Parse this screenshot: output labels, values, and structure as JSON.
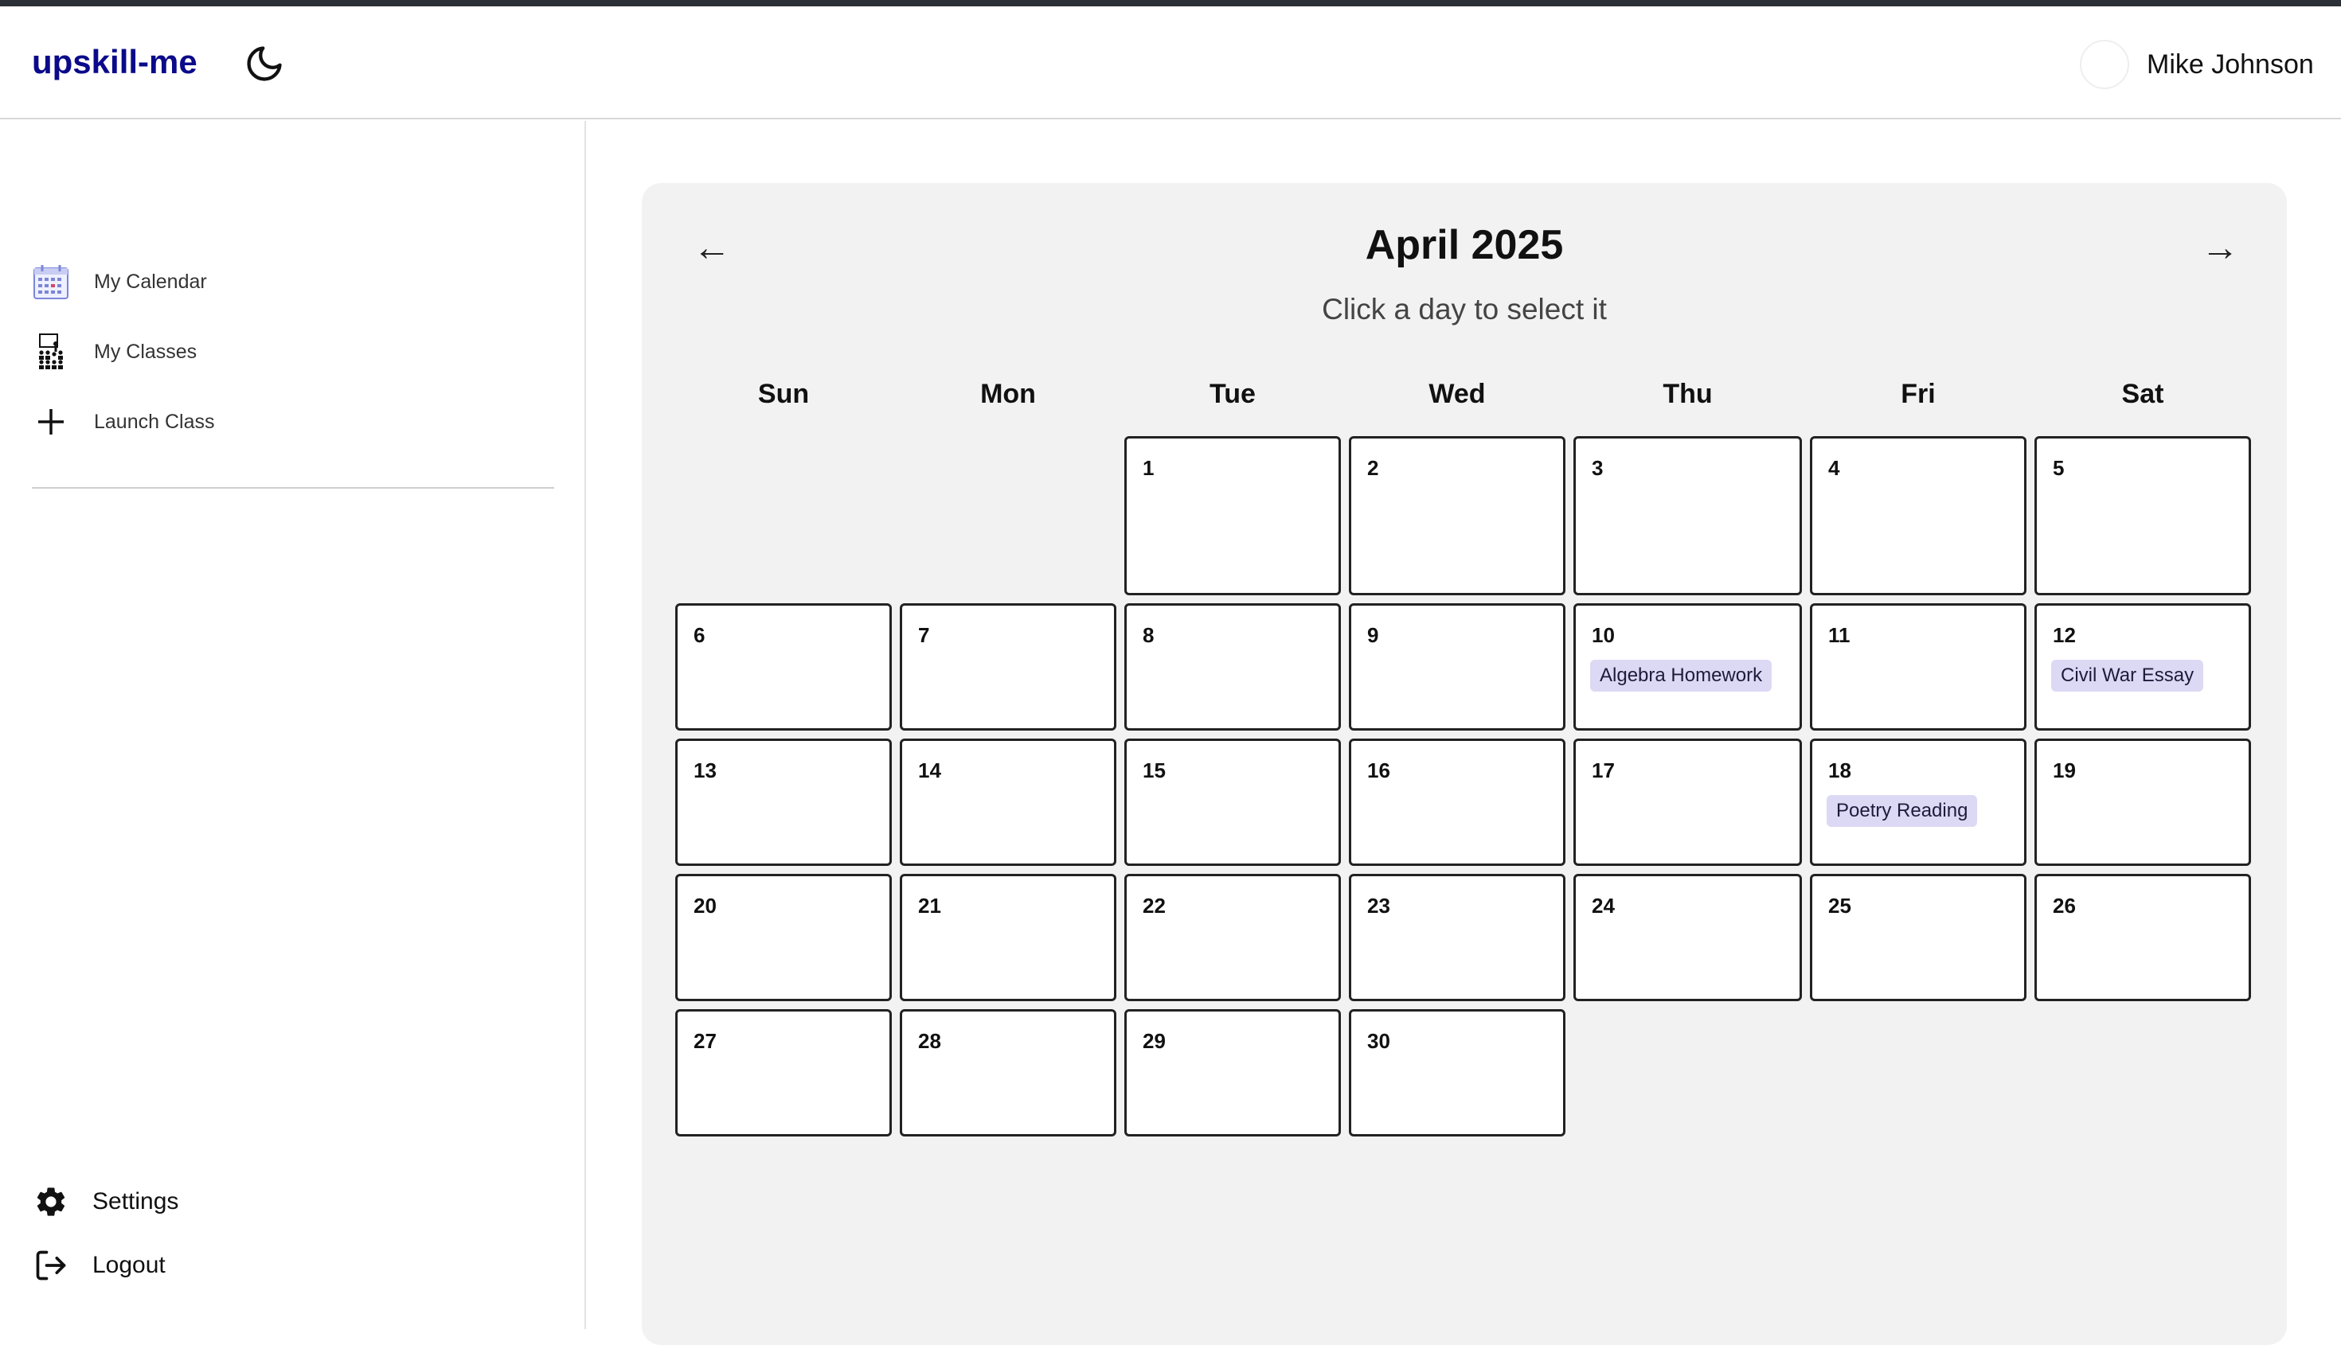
{
  "app": {
    "brand": "upskill-me",
    "user_name": "Mike Johnson"
  },
  "sidebar": {
    "items": [
      {
        "label": "My Calendar",
        "icon": "calendar-icon"
      },
      {
        "label": "My Classes",
        "icon": "classes-icon"
      },
      {
        "label": "Launch Class",
        "icon": "plus-icon"
      }
    ],
    "bottom": [
      {
        "label": "Settings",
        "icon": "gear-icon"
      },
      {
        "label": "Logout",
        "icon": "logout-icon"
      }
    ]
  },
  "calendar": {
    "title": "April 2025",
    "subtitle": "Click a day to select it",
    "prev_arrow": "←",
    "next_arrow": "→",
    "weekdays": [
      "Sun",
      "Mon",
      "Tue",
      "Wed",
      "Thu",
      "Fri",
      "Sat"
    ],
    "days": [
      "1",
      "2",
      "3",
      "4",
      "5",
      "6",
      "7",
      "8",
      "9",
      "10",
      "11",
      "12",
      "13",
      "14",
      "15",
      "16",
      "17",
      "18",
      "19",
      "20",
      "21",
      "22",
      "23",
      "24",
      "25",
      "26",
      "27",
      "28",
      "29",
      "30"
    ],
    "events": [
      {
        "day": "10",
        "label": "Algebra Homework"
      },
      {
        "day": "12",
        "label": "Civil War Essay"
      },
      {
        "day": "18",
        "label": "Poetry Reading"
      }
    ]
  },
  "colors": {
    "brand": "#0a0a8a",
    "event_chip": "#dcd9f5",
    "panel": "#f3f2f2"
  }
}
